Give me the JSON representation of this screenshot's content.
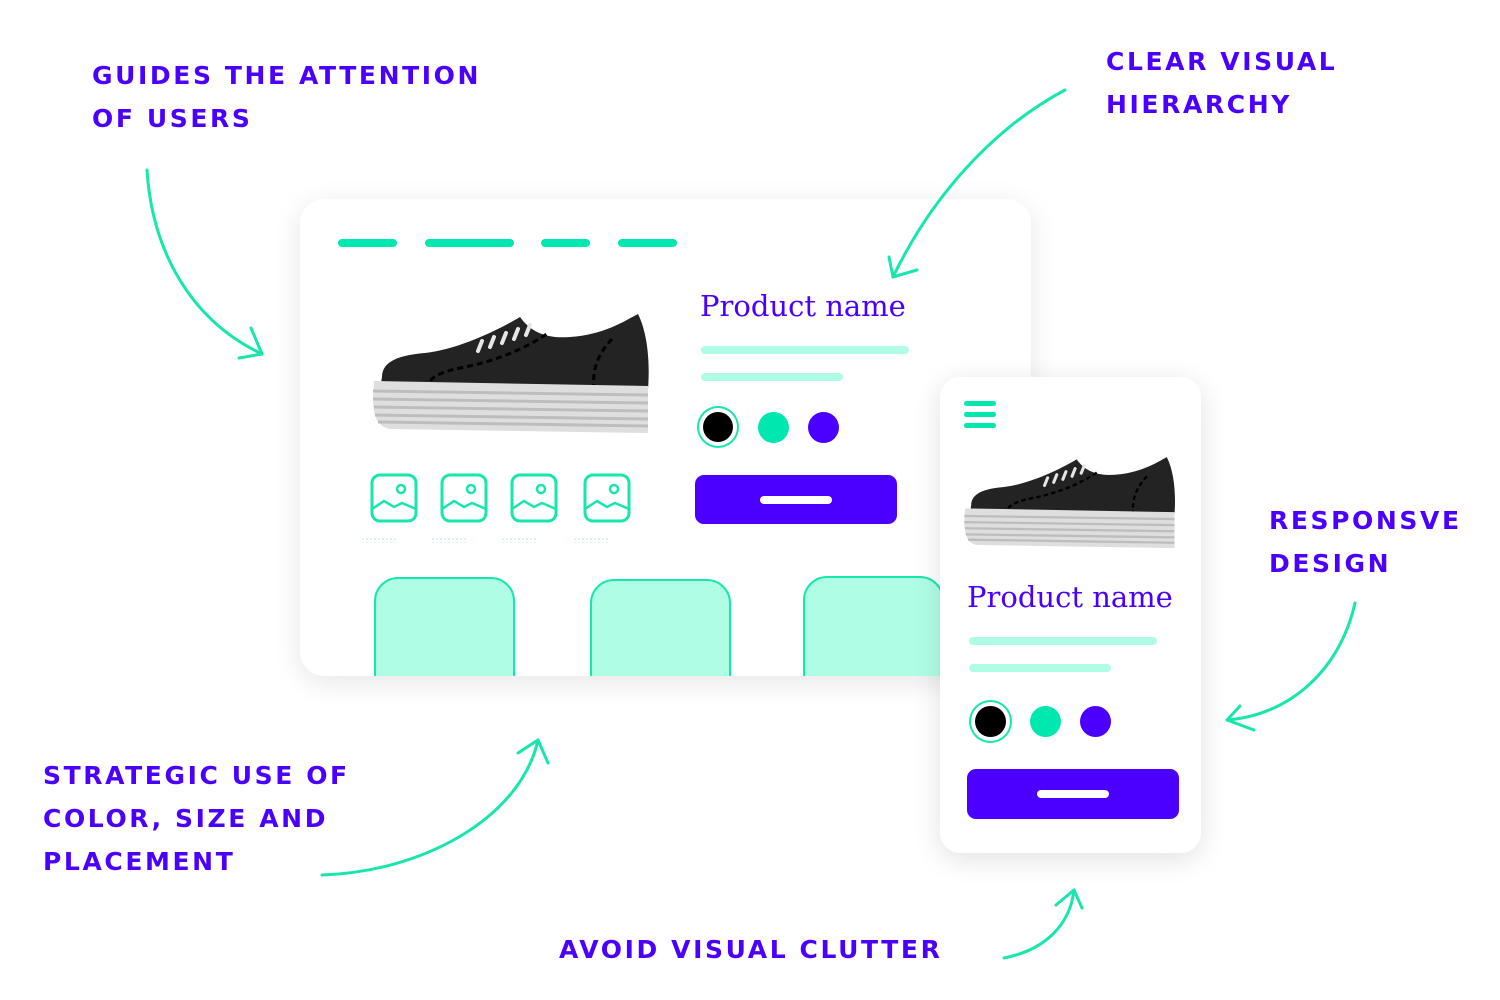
{
  "annotations": {
    "attention": [
      "Guides the attention",
      "of users"
    ],
    "hierarchy": [
      "Clear visual",
      "hierarchy"
    ],
    "strategic": [
      "Strategic use of",
      "color, size and",
      "placement"
    ],
    "responsive": [
      "Responsve",
      "design"
    ],
    "clutter": [
      "Avoid visual clutter"
    ]
  },
  "desktop_mockup": {
    "product_name": "Product name",
    "color_options": [
      {
        "name": "black",
        "color": "#000000",
        "selected": true
      },
      {
        "name": "mint",
        "color": "#00e8b0",
        "selected": false
      },
      {
        "name": "violet",
        "color": "#4b00ff",
        "selected": false
      }
    ],
    "nav_items": 4,
    "thumbnails": 4,
    "cards": 3
  },
  "mobile_mockup": {
    "product_name": "Product name",
    "color_options": [
      {
        "name": "black",
        "color": "#000000",
        "selected": true
      },
      {
        "name": "mint",
        "color": "#00e8b0",
        "selected": false
      },
      {
        "name": "violet",
        "color": "#4b00ff",
        "selected": false
      }
    ]
  },
  "colors": {
    "accent": "#4b00ff",
    "mint": "#00e8b0",
    "mint_light": "#b0fde6",
    "arrow": "#17e6ad",
    "shoe": "#232323",
    "sole": "#dedede"
  }
}
